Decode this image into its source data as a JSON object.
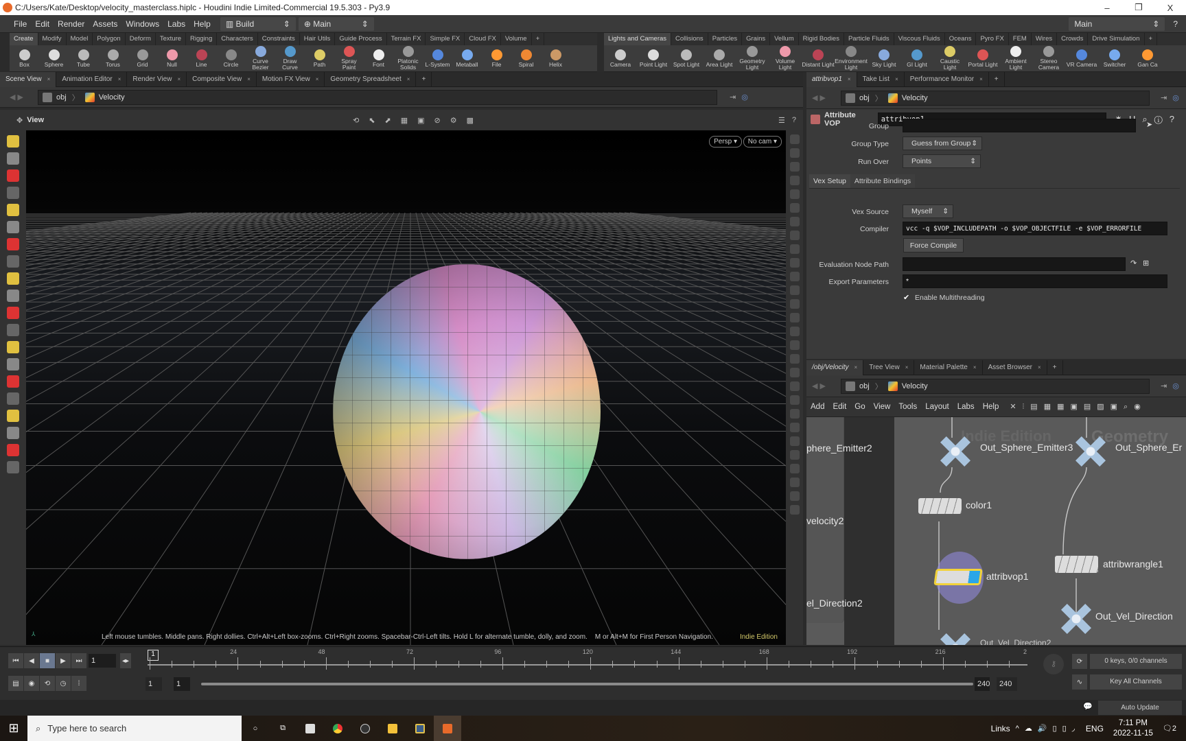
{
  "window": {
    "title": "C:/Users/Kate/Desktop/velocity_masterclass.hiplc - Houdini Indie Limited-Commercial 19.5.303 - Py3.9",
    "minimize": "–",
    "maximize": "❐",
    "close": "X"
  },
  "menubar": {
    "items": [
      "File",
      "Edit",
      "Render",
      "Assets",
      "Windows",
      "Labs",
      "Help"
    ],
    "desktop": "Build",
    "desktop_icon": "layout-icon",
    "context": "Main",
    "right_context": "Main",
    "help": "?"
  },
  "shelf_left": {
    "tabs": [
      "Create",
      "Modify",
      "Model",
      "Polygon",
      "Deform",
      "Texture",
      "Rigging",
      "Characters",
      "Constraints",
      "Hair Utils",
      "Guide Process",
      "Terrain FX",
      "Simple FX",
      "Cloud FX",
      "Volume"
    ],
    "tools": [
      "Box",
      "Sphere",
      "Tube",
      "Torus",
      "Grid",
      "Null",
      "Line",
      "Circle",
      "Curve Bezier",
      "Draw Curve",
      "Path",
      "Spray Paint",
      "Font",
      "Platonic Solids",
      "L-System",
      "Metaball",
      "File",
      "Spiral",
      "Helix"
    ]
  },
  "shelf_right": {
    "tabs": [
      "Lights and Cameras",
      "Collisions",
      "Particles",
      "Grains",
      "Vellum",
      "Rigid Bodies",
      "Particle Fluids",
      "Viscous Fluids",
      "Oceans",
      "Pyro FX",
      "FEM",
      "Wires",
      "Crowds",
      "Drive Simulation"
    ],
    "tools": [
      "Camera",
      "Point Light",
      "Spot Light",
      "Area Light",
      "Geometry Light",
      "Volume Light",
      "Distant Light",
      "Environment Light",
      "Sky Light",
      "GI Light",
      "Caustic Light",
      "Portal Light",
      "Ambient Light",
      "Stereo Camera",
      "VR Camera",
      "Switcher",
      "Gan Ca"
    ]
  },
  "scene_pane": {
    "tabs": [
      "Scene View",
      "Animation Editor",
      "Render View",
      "Composite View",
      "Motion FX View",
      "Geometry Spreadsheet"
    ],
    "path": [
      "obj",
      "Velocity"
    ],
    "view_label": "View",
    "persp": "Persp ▾",
    "cam": "No cam ▾",
    "hint": "Left mouse tumbles. Middle pans. Right dollies. Ctrl+Alt+Left box-zooms. Ctrl+Right zooms. Spacebar-Ctrl-Left tilts. Hold L for alternate tumble, dolly, and zoom.    M or Alt+M for First Person Navigation.",
    "edition": "Indie Edition"
  },
  "param_pane": {
    "tabs": [
      "attribvop1",
      "Take List",
      "Performance Monitor"
    ],
    "path": [
      "obj",
      "Velocity"
    ],
    "node_type": "Attribute VOP",
    "node_name": "attribvop1",
    "group_label": "Group",
    "group_value": "",
    "group_type_label": "Group Type",
    "group_type_value": "Guess from Group",
    "run_over_label": "Run Over",
    "run_over_value": "Points",
    "subtabs": [
      "Vex Setup",
      "Attribute Bindings"
    ],
    "vex_source_label": "Vex Source",
    "vex_source_value": "Myself",
    "compiler_label": "Compiler",
    "compiler_value": "vcc -q $VOP_INCLUDEPATH -o $VOP_OBJECTFILE -e $VOP_ERRORFILE",
    "force_compile": "Force Compile",
    "eval_path_label": "Evaluation Node Path",
    "eval_path_value": "",
    "export_label": "Export Parameters",
    "export_value": "*",
    "multithread_label": "Enable Multithreading",
    "multithread_checked": true
  },
  "network_pane": {
    "tabs": [
      "/obj/Velocity",
      "Tree View",
      "Material Palette",
      "Asset Browser"
    ],
    "path": [
      "obj",
      "Velocity"
    ],
    "menu": [
      "Add",
      "Edit",
      "Go",
      "View",
      "Tools",
      "Layout",
      "Labs",
      "Help"
    ],
    "watermark_left": "Indie Edition",
    "watermark_right": "Geometry",
    "nodes": {
      "sphere_emitter2": "phere_Emitter2",
      "velocity2": "velocity2",
      "vel_direction2": "el_Direction2",
      "out_sphere_emitter3": "Out_Sphere_Emitter3",
      "out_sphere_right": "Out_Sphere_Er",
      "color1": "color1",
      "attribvop1": "attribvop1",
      "attribwrangle1": "attribwrangle1",
      "out_vel_direction": "Out_Vel_Direction",
      "out_vel_direction_bottom": "Out_Vel_Direction2"
    },
    "colors": {
      "null_node": "#a9c4de",
      "selected_outline": "#f2d23a",
      "vop_flag": "#2aa6e8"
    }
  },
  "timeline": {
    "current_frame": "1",
    "frame_marker": "1",
    "ticks": [
      "24",
      "48",
      "72",
      "96",
      "120",
      "144",
      "168",
      "192",
      "216",
      "2"
    ],
    "range_start": "1",
    "range_start2": "1",
    "range_end": "240",
    "range_end2": "240",
    "keys_info": "0 keys, 0/0 channels",
    "key_all": "Key All Channels",
    "auto_update": "Auto Update"
  },
  "taskbar": {
    "search_placeholder": "Type here to search",
    "links": "Links",
    "lang": "ENG",
    "time": "7:11 PM",
    "date": "2022-11-15",
    "notifications": "2"
  }
}
